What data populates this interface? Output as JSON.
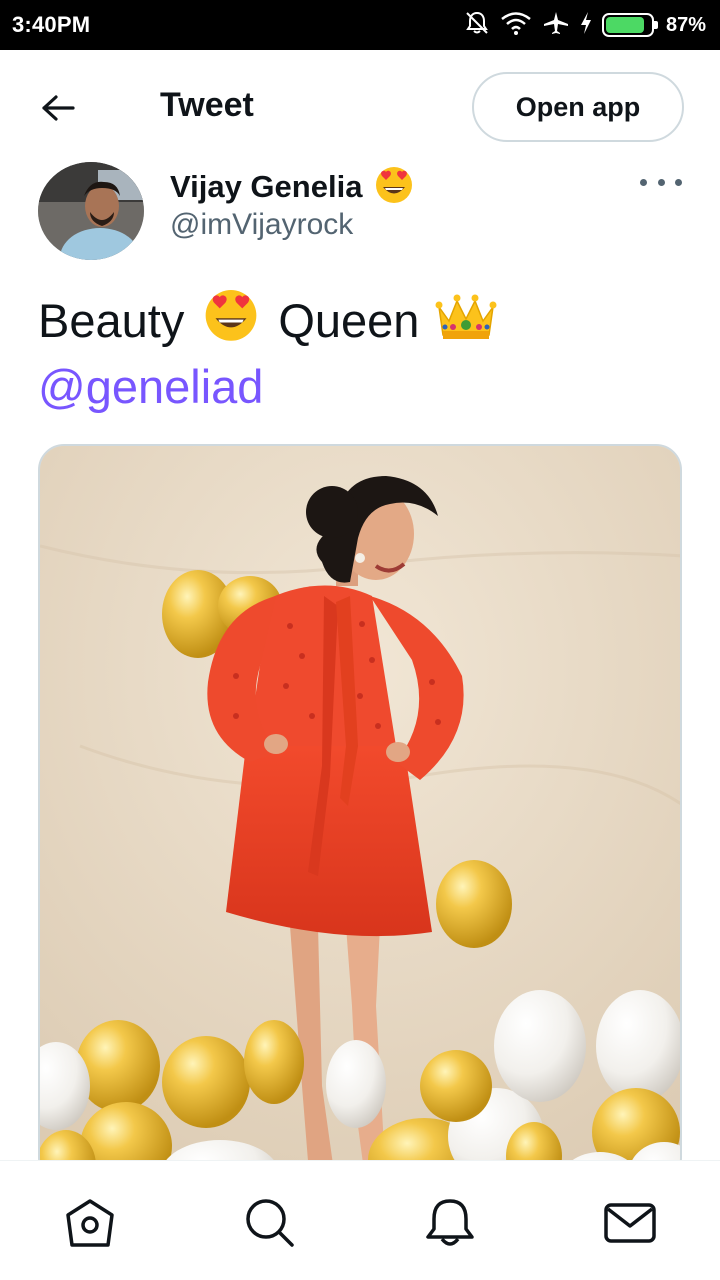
{
  "status_bar": {
    "time": "3:40PM",
    "battery_percent": "87%",
    "battery_level": 0.87,
    "icons": [
      "mute-icon",
      "wifi-icon",
      "airplane-icon",
      "charging-icon",
      "battery-icon"
    ]
  },
  "header": {
    "title": "Tweet",
    "back_icon": "arrow-left-icon",
    "open_app_label": "Open app"
  },
  "tweet": {
    "author": {
      "display_name": "Vijay Genelia",
      "name_emoji": "smiling-face-heart-eyes-emoji",
      "handle": "@imVijayrock"
    },
    "text": {
      "word1": "Beauty",
      "emoji1": "smiling-face-heart-eyes-emoji",
      "word2": "Queen",
      "emoji2": "crown-emoji",
      "mention": "@geneliad"
    },
    "media_description_icon": "photo"
  },
  "bottom_nav": {
    "items": [
      "home-icon",
      "search-icon",
      "notifications-icon",
      "messages-icon"
    ]
  },
  "colors": {
    "accent": "#7856ff",
    "text_primary": "#0f1419",
    "text_secondary": "#536471",
    "border": "#cfd9de"
  }
}
